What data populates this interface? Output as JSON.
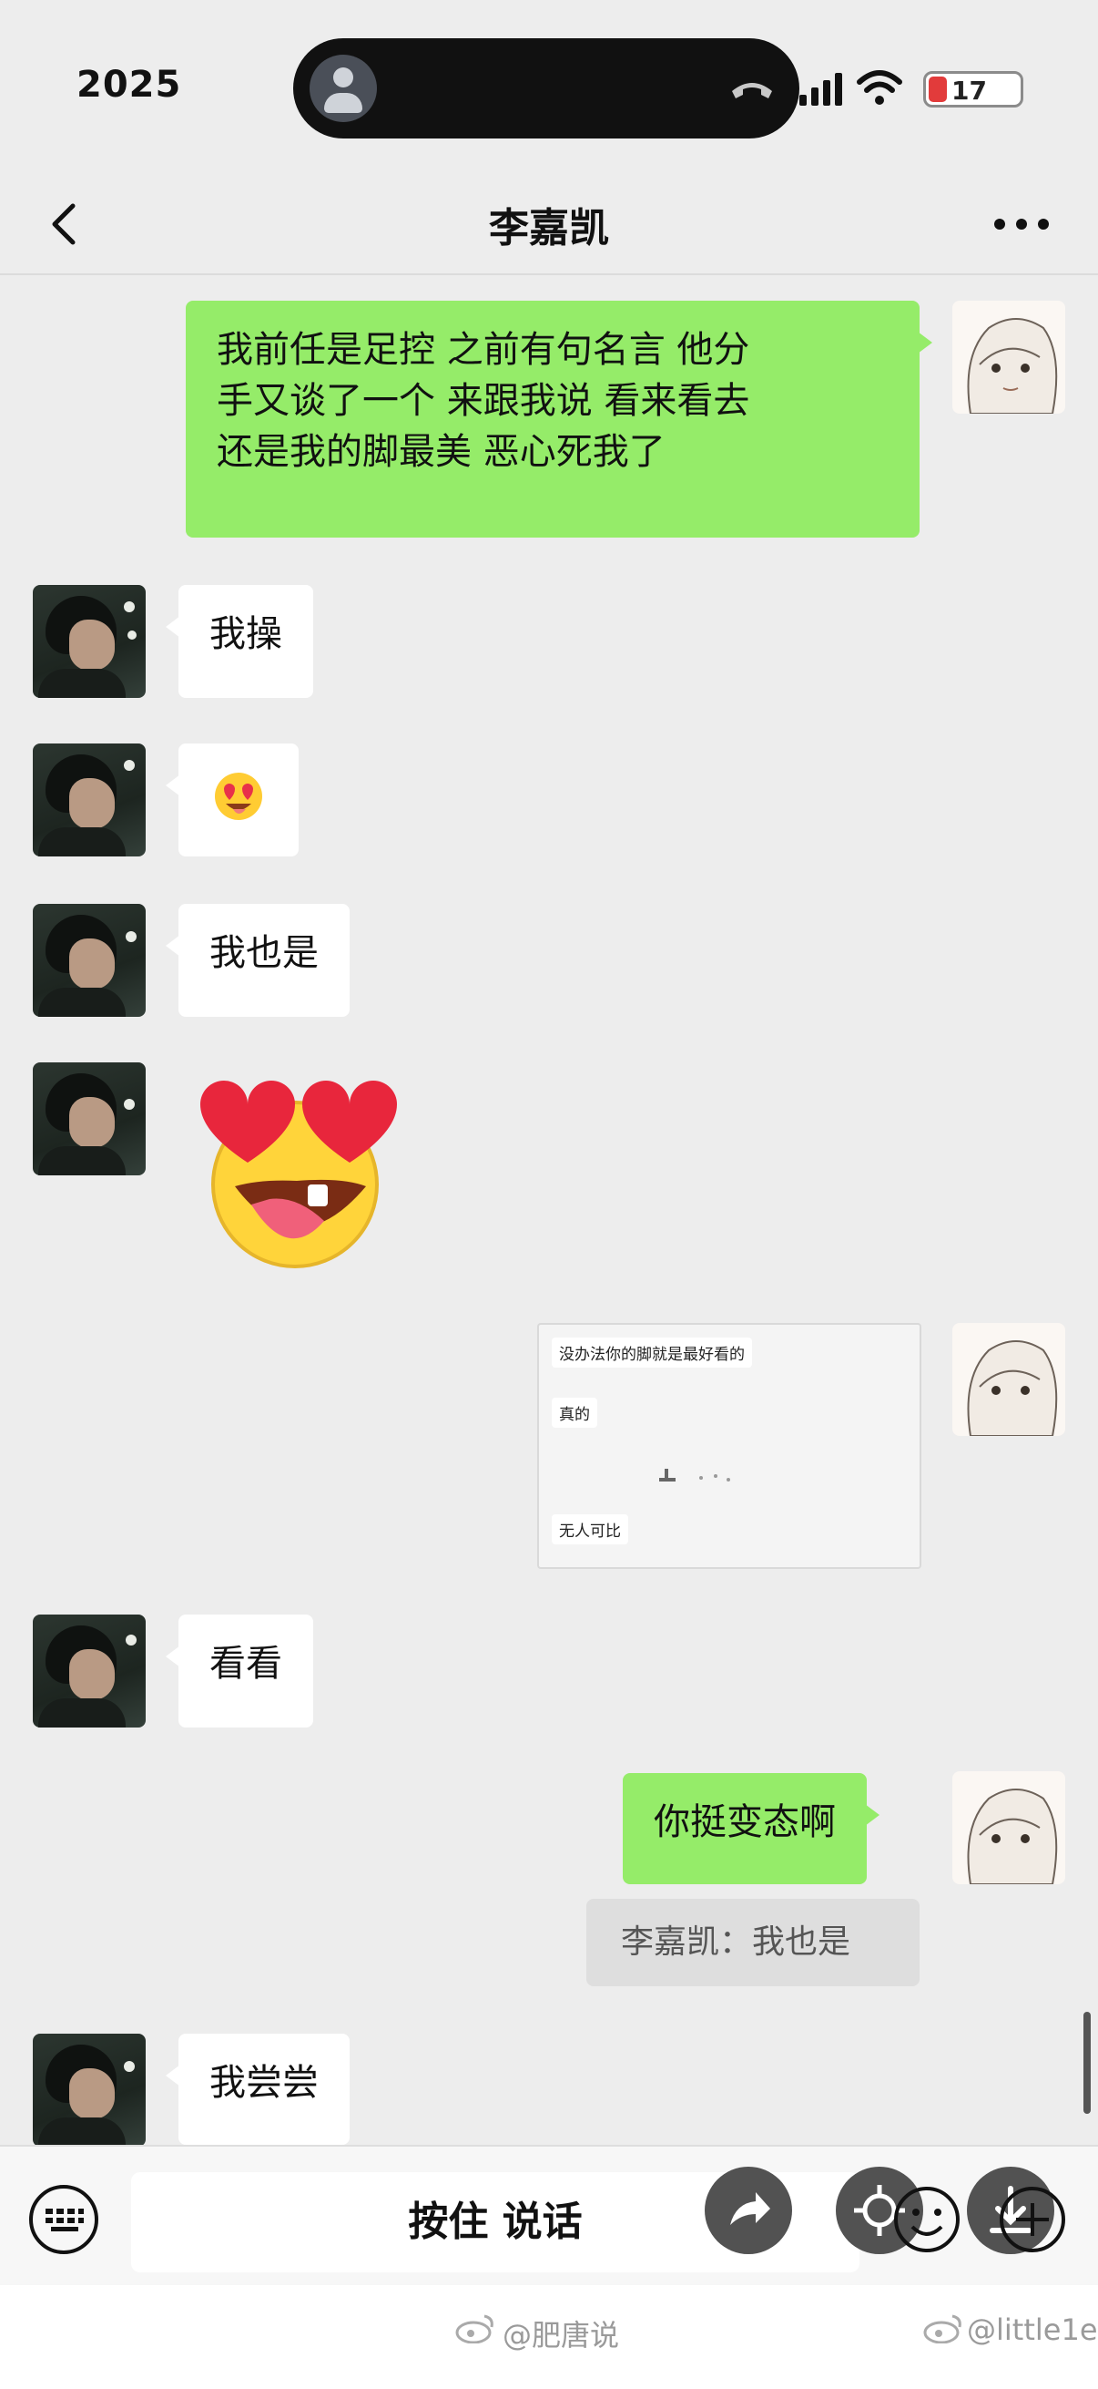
{
  "status_bar": {
    "time": "2025",
    "battery": "17"
  },
  "header": {
    "title": "李嘉凯"
  },
  "messages": [
    {
      "from": "me",
      "type": "text",
      "lines": [
        "我前任是足控 之前有句名言 他分",
        "手又谈了一个 来跟我说 看来看去",
        "还是我的脚最美 恶心死我了"
      ]
    },
    {
      "from": "other",
      "type": "text",
      "text": "我操"
    },
    {
      "from": "other",
      "type": "emoji",
      "icon": "heart-eyes-emoji-icon"
    },
    {
      "from": "other",
      "type": "text",
      "text": "我也是"
    },
    {
      "from": "other",
      "type": "sticker",
      "icon": "heart-eyes-sticker-icon"
    },
    {
      "from": "me",
      "type": "image",
      "screenshot_lines": [
        "没办法你的脚就是最好看的",
        "真的",
        "无人可比"
      ]
    },
    {
      "from": "other",
      "type": "text",
      "text": "看看"
    },
    {
      "from": "me",
      "type": "text",
      "text": "你挺变态啊"
    },
    {
      "from": "me",
      "type": "quote",
      "text": "李嘉凯：我也是"
    },
    {
      "from": "other",
      "type": "text",
      "text": "我尝尝"
    }
  ],
  "input_bar": {
    "talk_label": "按住 说话"
  },
  "watermarks": {
    "left": "@肥唐说",
    "right": "@little1e"
  },
  "colors": {
    "my_bubble": "#95ec69",
    "other_bubble": "#ffffff",
    "background": "#ededed"
  }
}
